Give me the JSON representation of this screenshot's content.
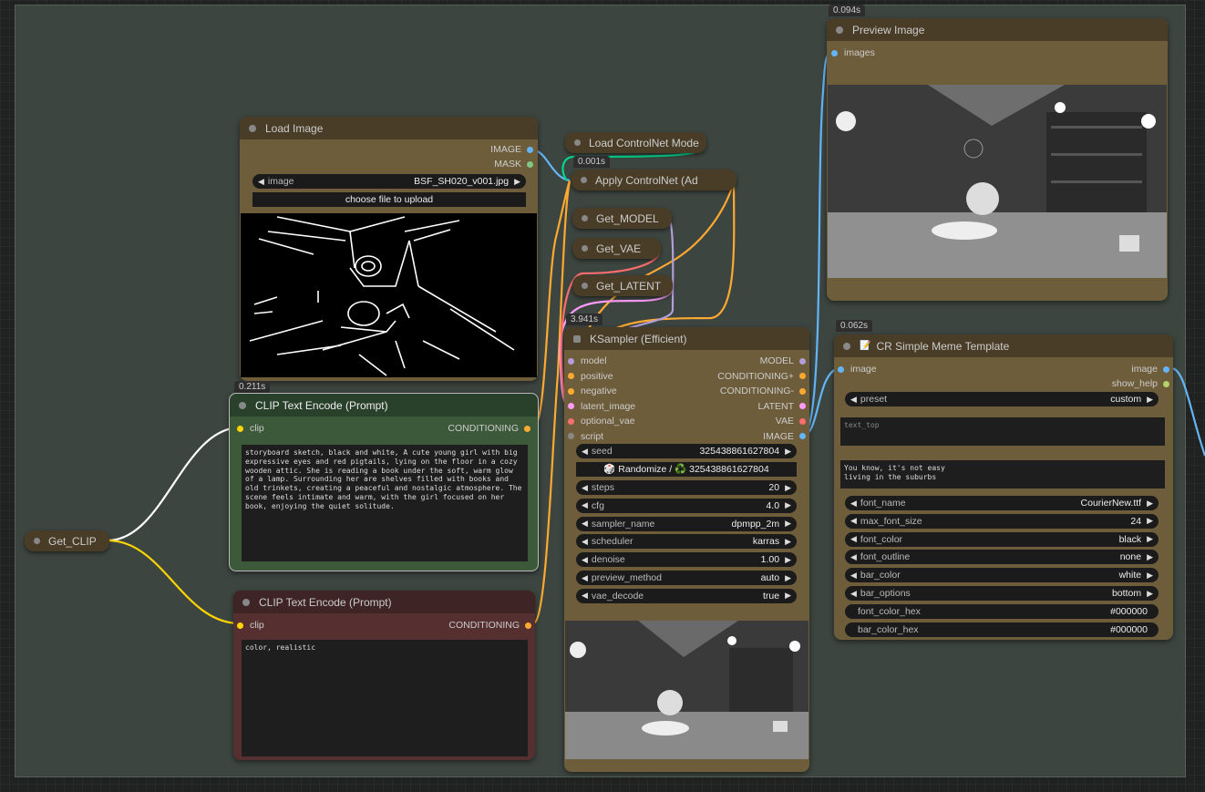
{
  "colors": {
    "model": "#b39ddb",
    "conditioning": "#ffa931",
    "clip": "#ffd500",
    "latent": "#ff9cf9",
    "vae": "#ff6e6e",
    "image": "#64b5f6",
    "mask": "#81c784",
    "control": "#00d78d"
  },
  "nodes": {
    "load_image": {
      "title": "Load Image",
      "out_image": "IMAGE",
      "out_mask": "MASK",
      "widget_label": "image",
      "widget_value": "BSF_SH020_v001.jpg",
      "upload_label": "choose file to upload"
    },
    "clip_pos": {
      "timing": "0.211s",
      "title": "CLIP Text Encode (Prompt)",
      "in_clip": "clip",
      "out": "CONDITIONING",
      "text": "storyboard sketch, black and white, A cute young girl with big expressive eyes and red pigtails, lying on the floor in a cozy wooden attic. She is reading a book under the soft, warm glow of a lamp. Surrounding her are shelves filled with books and old trinkets, creating a peaceful and nostalgic atmosphere. The scene feels intimate and warm, with the girl focused on her book, enjoying the quiet solitude."
    },
    "clip_neg": {
      "title": "CLIP Text Encode (Prompt)",
      "in_clip": "clip",
      "out": "CONDITIONING",
      "text": "color, realistic"
    },
    "get_clip": {
      "title": "Get_CLIP"
    },
    "load_controlnet": {
      "title": "Load ControlNet Mode"
    },
    "apply_controlnet": {
      "timing": "0.001s",
      "title": "Apply ControlNet (Ad"
    },
    "get_model": {
      "title": "Get_MODEL"
    },
    "get_vae": {
      "title": "Get_VAE"
    },
    "get_latent": {
      "title": "Get_LATENT"
    },
    "ksampler": {
      "timing": "3.941s",
      "title": "KSampler (Efficient)",
      "inputs": [
        "model",
        "positive",
        "negative",
        "latent_image",
        "optional_vae",
        "script"
      ],
      "outputs": [
        "MODEL",
        "CONDITIONING+",
        "CONDITIONING-",
        "LATENT",
        "VAE",
        "IMAGE"
      ],
      "seed_label": "seed",
      "seed_value": "325438861627804",
      "randomize_label": "🎲 Randomize / ♻️ 325438861627804",
      "widgets": [
        {
          "label": "steps",
          "value": "20"
        },
        {
          "label": "cfg",
          "value": "4.0"
        },
        {
          "label": "sampler_name",
          "value": "dpmpp_2m"
        },
        {
          "label": "scheduler",
          "value": "karras"
        },
        {
          "label": "denoise",
          "value": "1.00"
        },
        {
          "label": "preview_method",
          "value": "auto"
        },
        {
          "label": "vae_decode",
          "value": "true"
        }
      ]
    },
    "preview": {
      "timing": "0.094s",
      "title": "Preview Image",
      "in_images": "images"
    },
    "meme": {
      "timing": "0.062s",
      "title": "CR Simple Meme Template",
      "title_icon": "📝",
      "in_image": "image",
      "out_image": "image",
      "out_help": "show_help",
      "preset_label": "preset",
      "preset_value": "custom",
      "text_top_placeholder": "text_top",
      "text_bottom": "You know, it's not easy\nliving in the suburbs",
      "widgets": [
        {
          "label": "font_name",
          "value": "CourierNew.ttf"
        },
        {
          "label": "max_font_size",
          "value": "24"
        },
        {
          "label": "font_color",
          "value": "black"
        },
        {
          "label": "font_outline",
          "value": "none"
        },
        {
          "label": "bar_color",
          "value": "white"
        },
        {
          "label": "bar_options",
          "value": "bottom"
        }
      ],
      "hex_widgets": [
        {
          "label": "font_color_hex",
          "value": "#000000"
        },
        {
          "label": "bar_color_hex",
          "value": "#000000"
        }
      ]
    }
  }
}
